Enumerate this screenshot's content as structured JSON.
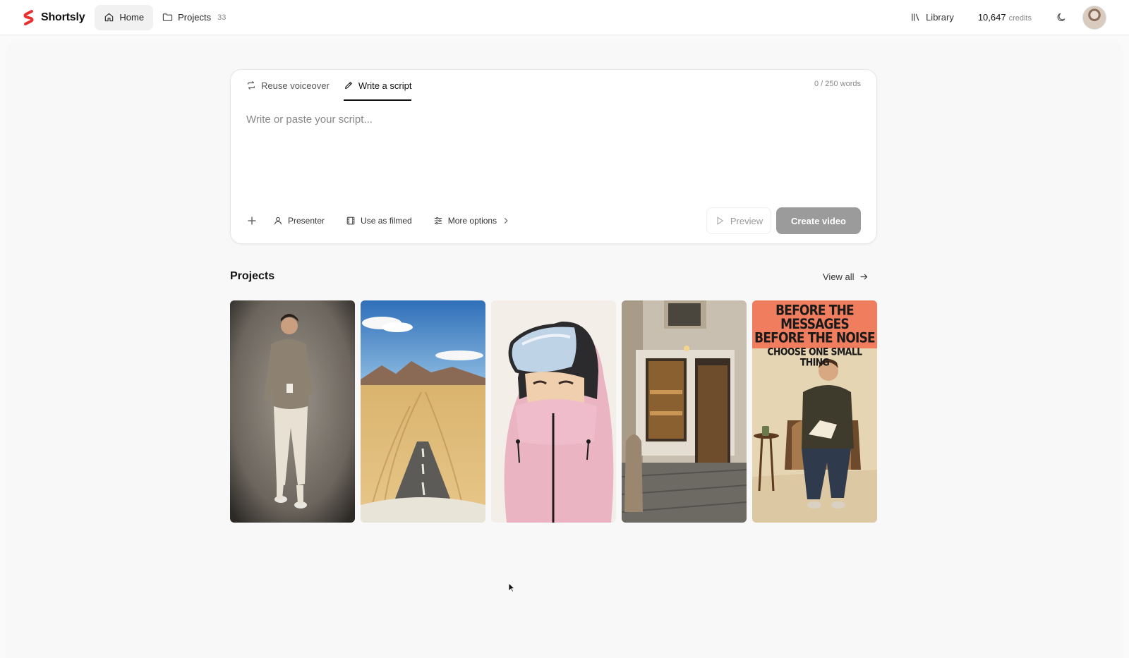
{
  "app": {
    "name": "Shortsly",
    "brand_color": "#e8312f"
  },
  "nav": {
    "home_label": "Home",
    "projects_label": "Projects",
    "projects_count": "33",
    "library_label": "Library",
    "credits_value": "10,647",
    "credits_unit": "credits",
    "theme_icon": "moon-icon"
  },
  "editor": {
    "tabs": [
      {
        "label": "Reuse voiceover",
        "icon": "repeat-icon",
        "active": false
      },
      {
        "label": "Write a script",
        "icon": "pencil-icon",
        "active": true
      }
    ],
    "word_count": "0 / 250 words",
    "placeholder": "Write or paste your script...",
    "value": "",
    "tools": {
      "presenter_label": "Presenter",
      "use_as_filmed_label": "Use as filmed",
      "more_options_label": "More options"
    },
    "preview_label": "Preview",
    "create_label": "Create video"
  },
  "projects": {
    "title": "Projects",
    "view_all_label": "View all",
    "items": [
      {
        "name": "man-walking-with-coffee"
      },
      {
        "name": "desert-road"
      },
      {
        "name": "pink-ski-jacket-illustration"
      },
      {
        "name": "parisian-bakery"
      },
      {
        "name": "man-reading-in-armchair",
        "overlay": [
          "BEFORE THE MESSAGES",
          "BEFORE THE NOISE",
          "CHOOSE ONE SMALL THING"
        ]
      }
    ]
  }
}
